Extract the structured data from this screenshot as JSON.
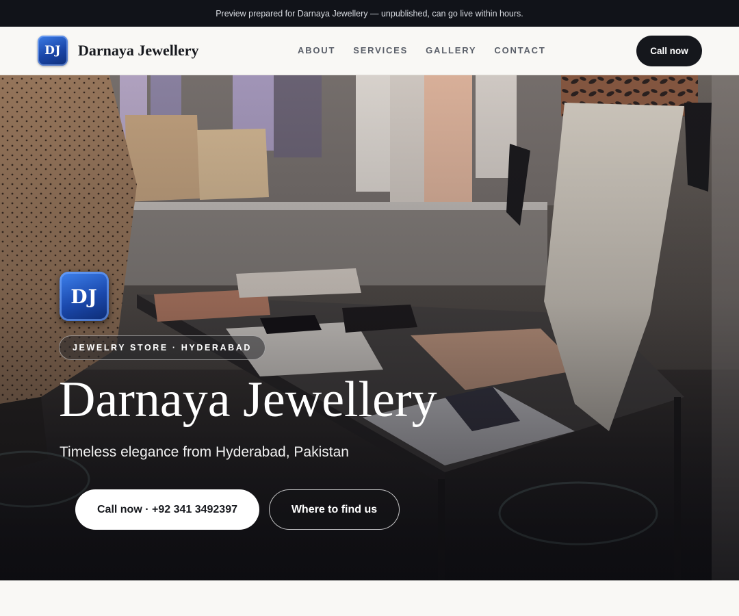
{
  "preview_banner": {
    "text": "Preview prepared for Darnaya Jewellery — unpublished, can go live within hours."
  },
  "header": {
    "logo_text": "DJ",
    "brand_name": "Darnaya Jewellery",
    "nav": [
      {
        "label": "ABOUT"
      },
      {
        "label": "SERVICES"
      },
      {
        "label": "GALLERY"
      },
      {
        "label": "CONTACT"
      }
    ],
    "call_button": "Call now"
  },
  "hero": {
    "logo_text": "DJ",
    "tag": "JEWELRY STORE · HYDERABAD",
    "title": "Darnaya Jewellery",
    "subtitle": "Timeless elegance from Hyderabad, Pakistan",
    "primary_button": "Call now · +92 341 3492397",
    "secondary_button": "Where to find us"
  },
  "colors": {
    "dark": "#15171c",
    "page_background": "#f9f8f5",
    "logo_blue": "#1a46a8"
  }
}
